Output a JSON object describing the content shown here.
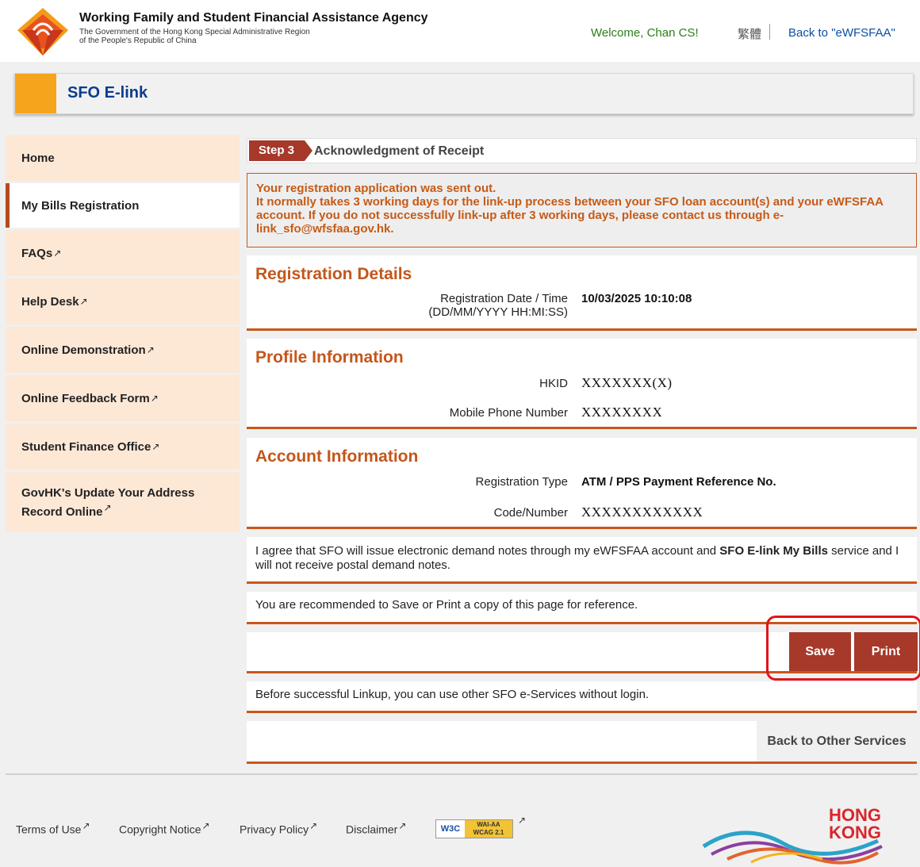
{
  "header": {
    "agency_name": "Working Family and Student Financial Assistance Agency",
    "agency_sub_1": "The Government of the Hong Kong Special Administrative Region",
    "agency_sub_2": "of the People's Republic of China",
    "welcome": "Welcome, Chan CS!",
    "language_link": "繁體",
    "back_link": "Back to \"eWFSFAA\""
  },
  "titlebar": {
    "title": "SFO E-link"
  },
  "sidebar": {
    "items": [
      {
        "label": "Home",
        "external": false
      },
      {
        "label": "My Bills Registration",
        "external": false,
        "active": true
      },
      {
        "label": "FAQs",
        "external": true
      },
      {
        "label": "Help Desk",
        "external": true
      },
      {
        "label": "Online Demonstration",
        "external": true
      },
      {
        "label": "Online Feedback Form",
        "external": true
      },
      {
        "label": "Student Finance Office",
        "external": true
      },
      {
        "label_line1": "GovHK's Update Your Address",
        "label_line2": "Record Online",
        "external": true
      }
    ]
  },
  "step": {
    "badge": "Step 3",
    "title": "Acknowledgment of Receipt"
  },
  "alert": {
    "line1": "Your registration application was sent out.",
    "line2": "It normally takes 3 working days for the link-up process between your SFO loan account(s) and your eWFSFAA account. If you do not successfully link-up after 3 working days, please contact us through e-link_sfo@wfsfaa.gov.hk."
  },
  "registration": {
    "title": "Registration Details",
    "date_label_1": "Registration Date / Time",
    "date_label_2": "(DD/MM/YYYY HH:MI:SS)",
    "date_value": "10/03/2025 10:10:08"
  },
  "profile": {
    "title": "Profile Information",
    "hkid_label": "HKID",
    "hkid_value": "XXXXXXX(X)",
    "mobile_label": "Mobile Phone Number",
    "mobile_value": "XXXXXXXX"
  },
  "account": {
    "title": "Account Information",
    "type_label": "Registration Type",
    "type_value": "ATM / PPS Payment Reference No.",
    "code_label": "Code/Number",
    "code_value": "XXXXXXXXXXXX"
  },
  "agreement": {
    "part1": "I agree that SFO will issue electronic demand notes through my eWFSFAA account and ",
    "part2": "SFO E-link My Bills",
    "part3": " service and I will not receive postal demand notes."
  },
  "recommend": "You are recommended to Save or Print a copy of this page for reference.",
  "buttons": {
    "save": "Save",
    "print": "Print"
  },
  "linkup_note": "Before successful Linkup, you can use other SFO e-Services without login.",
  "back_services": "Back to Other Services",
  "footer": {
    "terms": "Terms of Use",
    "copyright": "Copyright Notice",
    "privacy": "Privacy Policy",
    "disclaimer": "Disclaimer",
    "w3c": "W3C",
    "wai_aa": "WAI-AA",
    "wcag": "WCAG 2.1",
    "hk_logo_text_1": "HONG",
    "hk_logo_text_2": "KONG"
  },
  "colors": {
    "accent": "#c4561a",
    "button": "#a6392a",
    "nav_bg": "#fde8d6",
    "highlight": "#e1141a"
  }
}
